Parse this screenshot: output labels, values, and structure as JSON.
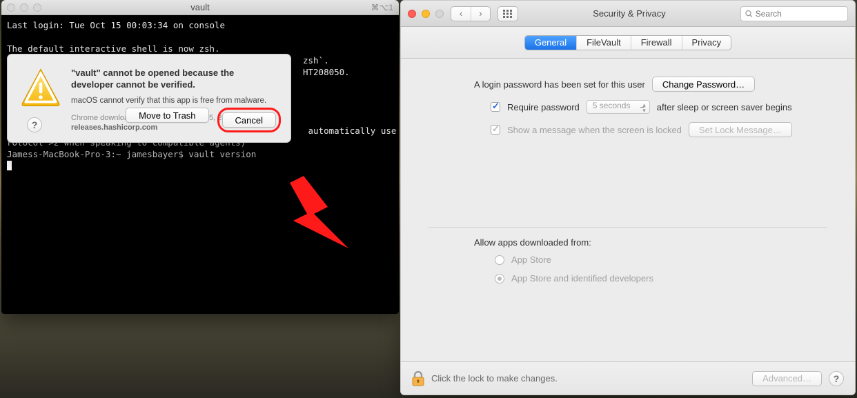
{
  "terminal": {
    "title": "vault",
    "shortcut": "⌘⌥1",
    "line1": "Last login: Tue Oct 15 00:03:34 on console",
    "line2": "",
    "line3": "The default interactive shell is now zsh.",
    "line4_tail": "zsh`.",
    "line5_tail": "HT208050.",
    "line6_tail": " automatically use p",
    "line7": "rotocol >2 when speaking to compatible agents)",
    "prompt": "Jamess-MacBook-Pro-3:~ jamesbayer$ ",
    "command": "vault version"
  },
  "alert": {
    "headline": "\"vault\" cannot be opened because the developer cannot be verified.",
    "sub": "macOS cannot verify that this app is free from malware.",
    "meta_prefix": "Chrome downloaded this file on August 15, 2019 from ",
    "meta_source": "releases.hashicorp.com",
    "trash_label": "Move to Trash",
    "cancel_label": "Cancel",
    "help_label": "?"
  },
  "sp": {
    "title": "Security & Privacy",
    "search_placeholder": "Search",
    "tabs": {
      "general": "General",
      "filevault": "FileVault",
      "firewall": "Firewall",
      "privacy": "Privacy"
    },
    "login_msg": "A login password has been set for this user",
    "change_pw": "Change Password…",
    "require_pw": "Require password",
    "delay": "5 seconds",
    "after": "after sleep or screen saver begins",
    "show_msg": "Show a message when the screen is locked",
    "set_lock": "Set Lock Message…",
    "allow_head": "Allow apps downloaded from:",
    "r1": "App Store",
    "r2": "App Store and identified developers",
    "lock_text": "Click the lock to make changes.",
    "advanced": "Advanced…",
    "help_label": "?"
  }
}
